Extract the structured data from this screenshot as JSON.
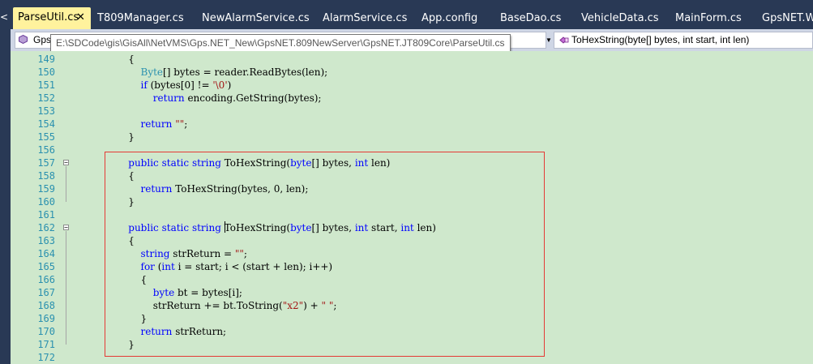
{
  "tabs": [
    {
      "label": "ParseUtil.cs",
      "active": true,
      "close": "✕"
    },
    {
      "label": "T809Manager.cs"
    },
    {
      "label": "NewAlarmService.cs"
    },
    {
      "label": "AlarmService.cs"
    },
    {
      "label": "App.config"
    },
    {
      "label": "BaseDao.cs"
    },
    {
      "label": "VehicleData.cs"
    },
    {
      "label": "MainForm.cs"
    },
    {
      "label": "GpsNET.We"
    }
  ],
  "tab_scroll_glyph": "<",
  "navbar": {
    "type_combo": "Gps",
    "member_combo": "ToHexString(byte[] bytes, int start, int len)",
    "dropdown_arrow": "▼"
  },
  "tooltip": "E:\\SDCode\\gis\\GisAll\\NetVMS\\Gps.NET_New\\GpsNET.809NewServer\\GpsNET.JT809Core\\ParseUtil.cs",
  "code_lines": [
    {
      "n": "149",
      "tokens": [
        {
          "t": "    {",
          "c": ""
        }
      ]
    },
    {
      "n": "150",
      "tokens": [
        {
          "t": "        ",
          "c": ""
        },
        {
          "t": "Byte",
          "c": "ty"
        },
        {
          "t": "[] bytes = reader.ReadBytes(len);",
          "c": ""
        }
      ]
    },
    {
      "n": "151",
      "tokens": [
        {
          "t": "        ",
          "c": ""
        },
        {
          "t": "if",
          "c": "kw"
        },
        {
          "t": " (bytes[0] != ",
          "c": ""
        },
        {
          "t": "'\\0'",
          "c": "str"
        },
        {
          "t": ")",
          "c": ""
        }
      ]
    },
    {
      "n": "152",
      "tokens": [
        {
          "t": "            ",
          "c": ""
        },
        {
          "t": "return",
          "c": "kw"
        },
        {
          "t": " encoding.GetString(bytes);",
          "c": ""
        }
      ]
    },
    {
      "n": "153",
      "tokens": []
    },
    {
      "n": "154",
      "tokens": [
        {
          "t": "        ",
          "c": ""
        },
        {
          "t": "return",
          "c": "kw"
        },
        {
          "t": " ",
          "c": ""
        },
        {
          "t": "\"\"",
          "c": "str"
        },
        {
          "t": ";",
          "c": ""
        }
      ]
    },
    {
      "n": "155",
      "tokens": [
        {
          "t": "    }",
          "c": ""
        }
      ]
    },
    {
      "n": "156",
      "tokens": []
    },
    {
      "n": "157",
      "fold": "−",
      "tokens": [
        {
          "t": "    ",
          "c": ""
        },
        {
          "t": "public",
          "c": "kw"
        },
        {
          "t": " ",
          "c": ""
        },
        {
          "t": "static",
          "c": "kw"
        },
        {
          "t": " ",
          "c": ""
        },
        {
          "t": "string",
          "c": "kw"
        },
        {
          "t": " ToHexString(",
          "c": ""
        },
        {
          "t": "byte",
          "c": "kw"
        },
        {
          "t": "[] bytes, ",
          "c": ""
        },
        {
          "t": "int",
          "c": "kw"
        },
        {
          "t": " len)",
          "c": ""
        }
      ]
    },
    {
      "n": "158",
      "tokens": [
        {
          "t": "    {",
          "c": ""
        }
      ]
    },
    {
      "n": "159",
      "tokens": [
        {
          "t": "        ",
          "c": ""
        },
        {
          "t": "return",
          "c": "kw"
        },
        {
          "t": " ToHexString(bytes, 0, len);",
          "c": ""
        }
      ]
    },
    {
      "n": "160",
      "tokens": [
        {
          "t": "    }",
          "c": ""
        }
      ]
    },
    {
      "n": "161",
      "tokens": []
    },
    {
      "n": "162",
      "fold": "−",
      "tokens": [
        {
          "t": "    ",
          "c": ""
        },
        {
          "t": "public",
          "c": "kw"
        },
        {
          "t": " ",
          "c": ""
        },
        {
          "t": "static",
          "c": "kw"
        },
        {
          "t": " ",
          "c": ""
        },
        {
          "t": "string",
          "c": "kw"
        },
        {
          "t": " ",
          "c": ""
        },
        {
          "t": "|",
          "c": "caret"
        },
        {
          "t": "ToHexString(",
          "c": ""
        },
        {
          "t": "byte",
          "c": "kw"
        },
        {
          "t": "[] bytes, ",
          "c": ""
        },
        {
          "t": "int",
          "c": "kw"
        },
        {
          "t": " start, ",
          "c": ""
        },
        {
          "t": "int",
          "c": "kw"
        },
        {
          "t": " len)",
          "c": ""
        }
      ]
    },
    {
      "n": "163",
      "tokens": [
        {
          "t": "    {",
          "c": ""
        }
      ]
    },
    {
      "n": "164",
      "tokens": [
        {
          "t": "        ",
          "c": ""
        },
        {
          "t": "string",
          "c": "kw"
        },
        {
          "t": " strReturn = ",
          "c": ""
        },
        {
          "t": "\"\"",
          "c": "str"
        },
        {
          "t": ";",
          "c": ""
        }
      ]
    },
    {
      "n": "165",
      "tokens": [
        {
          "t": "        ",
          "c": ""
        },
        {
          "t": "for",
          "c": "kw"
        },
        {
          "t": " (",
          "c": ""
        },
        {
          "t": "int",
          "c": "kw"
        },
        {
          "t": " i = start; i < (start + len); i++)",
          "c": ""
        }
      ]
    },
    {
      "n": "166",
      "tokens": [
        {
          "t": "        {",
          "c": ""
        }
      ]
    },
    {
      "n": "167",
      "tokens": [
        {
          "t": "            ",
          "c": ""
        },
        {
          "t": "byte",
          "c": "kw"
        },
        {
          "t": " bt = bytes[i];",
          "c": ""
        }
      ]
    },
    {
      "n": "168",
      "tokens": [
        {
          "t": "            strReturn += bt.ToString(",
          "c": ""
        },
        {
          "t": "\"x2\"",
          "c": "str"
        },
        {
          "t": ") + ",
          "c": ""
        },
        {
          "t": "\" \"",
          "c": "str"
        },
        {
          "t": ";",
          "c": ""
        }
      ]
    },
    {
      "n": "169",
      "tokens": [
        {
          "t": "        }",
          "c": ""
        }
      ]
    },
    {
      "n": "170",
      "tokens": [
        {
          "t": "        ",
          "c": ""
        },
        {
          "t": "return",
          "c": "kw"
        },
        {
          "t": " strReturn;",
          "c": ""
        }
      ]
    },
    {
      "n": "171",
      "tokens": [
        {
          "t": "    }",
          "c": ""
        }
      ]
    },
    {
      "n": "172",
      "tokens": []
    }
  ],
  "colors": {
    "chrome": "#293955",
    "active_tab": "#fff29d",
    "editor_bg": "#cfe8cc",
    "keyword": "#0000ff",
    "type": "#2b91af",
    "string": "#a31515",
    "line_number": "#2b91af",
    "highlight_box": "#e53935"
  }
}
